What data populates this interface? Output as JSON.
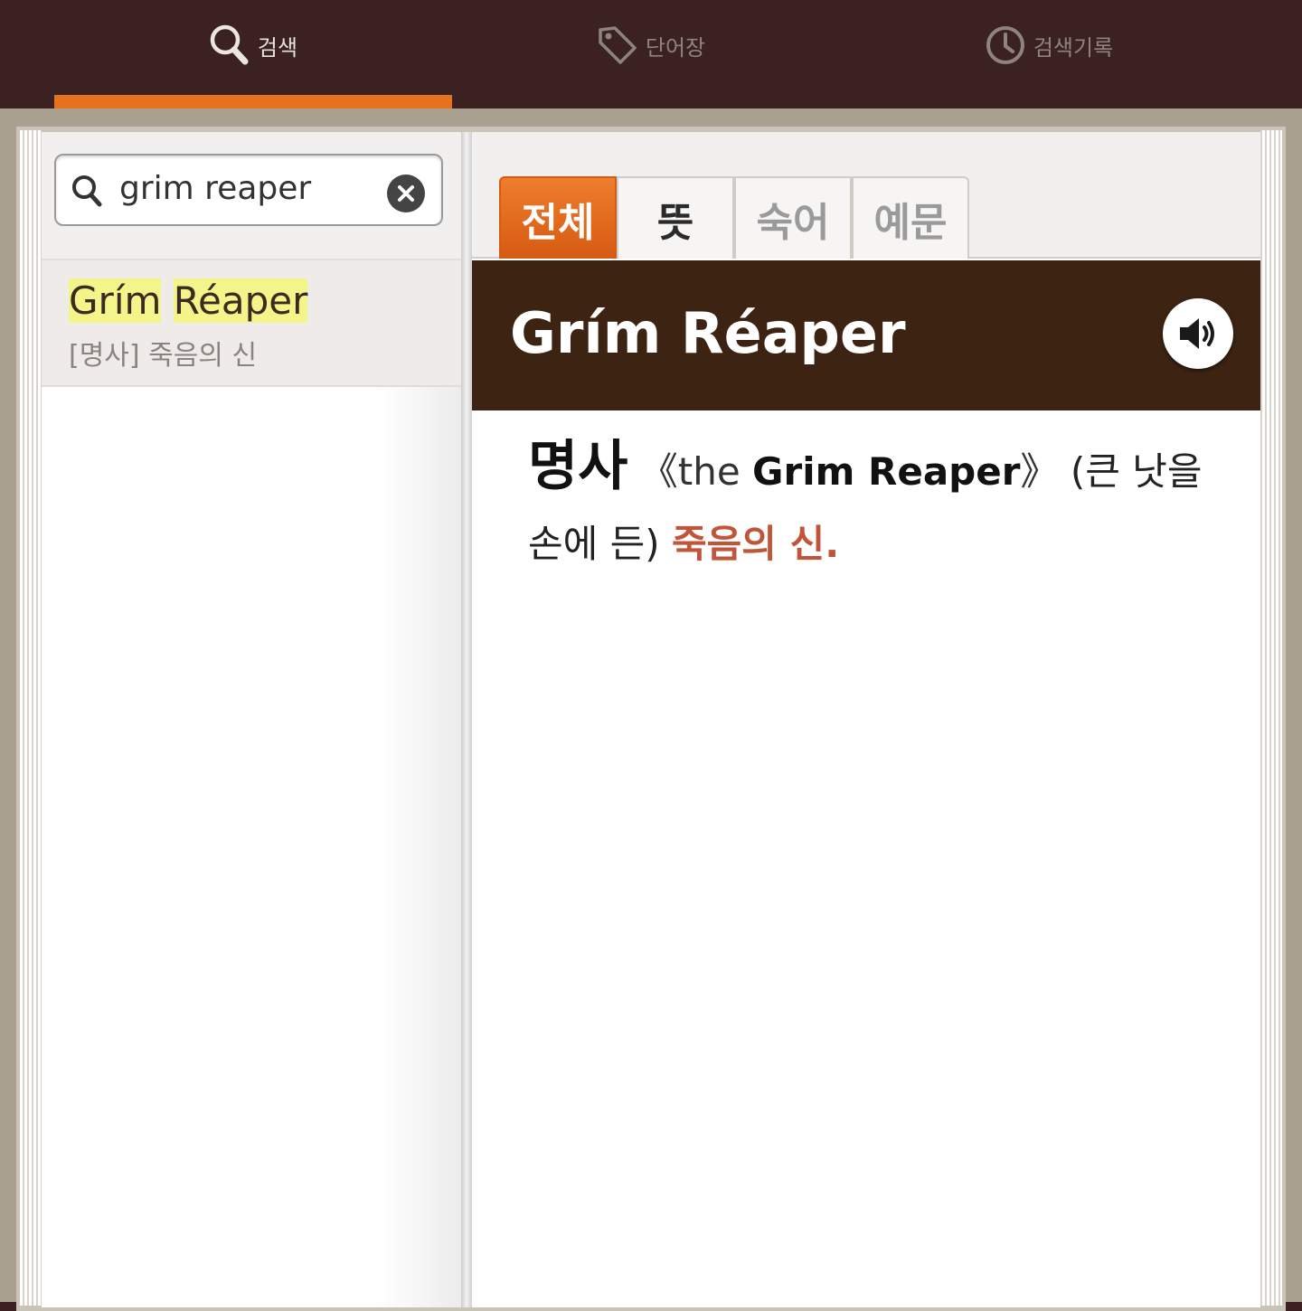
{
  "nav": {
    "tabs": [
      {
        "label": "검색",
        "icon": "search-icon",
        "active": true
      },
      {
        "label": "단어장",
        "icon": "tag-icon",
        "active": false
      },
      {
        "label": "검색기록",
        "icon": "clock-icon",
        "active": false
      }
    ]
  },
  "search": {
    "value": "grim reaper",
    "icon": "search-icon",
    "clear_icon": "close-icon"
  },
  "results": [
    {
      "word_part1": "Grím",
      "word_part2": "Réaper",
      "summary": "[명사] 죽음의 신"
    }
  ],
  "entry": {
    "tabs": [
      "전체",
      "뜻",
      "숙어",
      "예문"
    ],
    "active_tab": "전체",
    "headword": "Grím Réaper",
    "speaker_icon": "speaker-icon",
    "definition": {
      "pos": "명사",
      "bracket_open": "《the ",
      "bold_term": "Grim Reaper",
      "bracket_close": "》",
      "paren_text": " (큰 낫을 손에 든) ",
      "meaning": "죽음의 신."
    }
  },
  "colors": {
    "accent": "#e6711f",
    "topbar": "#3b2220",
    "banner": "#3d2311",
    "highlight": "#f3f48a",
    "meaning": "#c0553a"
  }
}
